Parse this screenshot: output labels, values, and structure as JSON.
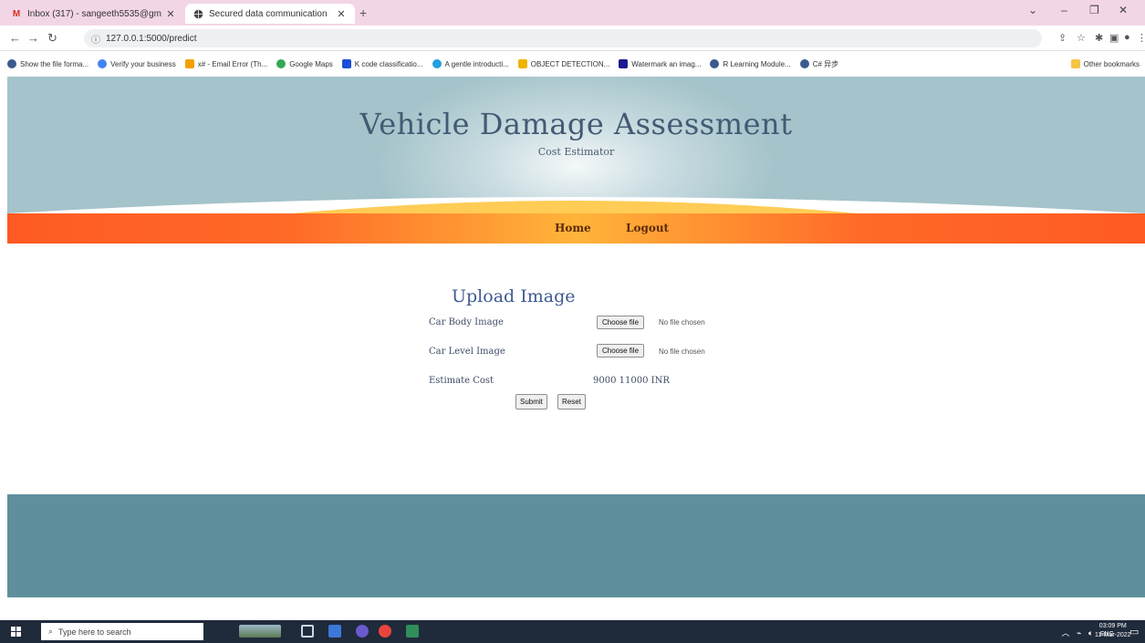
{
  "browser": {
    "tabs": [
      {
        "title": "Inbox (317) - sangeeth5535@gm",
        "icon": "gmail-icon"
      },
      {
        "title": "Secured data communication",
        "icon": "globe-icon"
      }
    ],
    "new_tab": "+",
    "url": "127.0.0.1:5000/predict",
    "bookmarks": [
      {
        "label": "Show the file forma...",
        "color": "#3b5b8f"
      },
      {
        "label": "Verify your business",
        "color": "#4285f4"
      },
      {
        "label": "x# - Email Error (Th...",
        "color": "#f4a000"
      },
      {
        "label": "Google Maps",
        "color": "#34a853"
      },
      {
        "label": "K code classificatio...",
        "color": "#1a4fd6"
      },
      {
        "label": "A gentle introducti...",
        "color": "#21a0e0"
      },
      {
        "label": "OBJECT DETECTION...",
        "color": "#f0b400"
      },
      {
        "label": "Watermark an imag...",
        "color": "#1b1b8f"
      },
      {
        "label": "R Learning Module...",
        "color": "#3b5b8f"
      },
      {
        "label": "C# 异步",
        "color": "#3b5b8f"
      }
    ],
    "other_bookmarks": "Other bookmarks"
  },
  "site": {
    "title": "Vehicle Damage Assessment",
    "subtitle": "Cost Estimator",
    "nav": {
      "home": "Home",
      "logout": "Logout"
    }
  },
  "form": {
    "heading": "Upload Image",
    "body_label": "Car Body Image",
    "level_label": "Car Level Image",
    "choose_label": "Choose file",
    "no_file": "No file chosen",
    "estimate_label": "Estimate Cost",
    "estimate_value": "9000 11000 INR",
    "submit": "Submit",
    "reset": "Reset"
  },
  "taskbar": {
    "search_placeholder": "Type here to search",
    "lang": "ENG",
    "time": "03:09 PM",
    "date": "11-Mar-2022"
  },
  "colors": {
    "hero": "#a4c3ca",
    "nav_orange": "#ff5a22",
    "footer": "#5f8f9c",
    "title": "#425a73"
  }
}
